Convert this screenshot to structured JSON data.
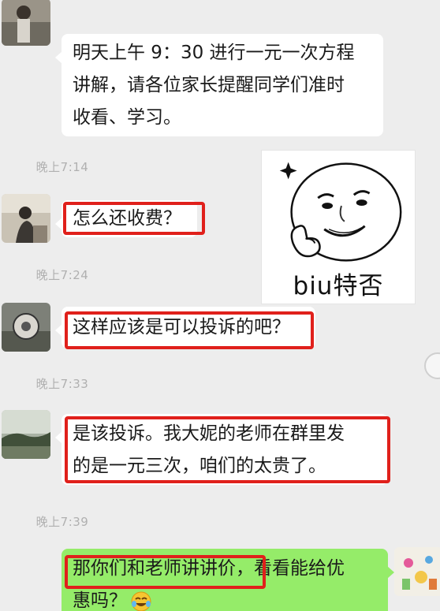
{
  "messages": [
    {
      "lines": [
        "明天上午 9：30 进行一元一次方程",
        "讲解，请各位家长提醒同学们准时",
        "收看、学习。"
      ]
    },
    {
      "text": "怎么还收费？"
    },
    {
      "text": "这样应该是可以投诉的吧？"
    },
    {
      "lines": [
        "是该投诉。我大妮的老师在群里发",
        "的是一元三次，咱们的太贵了。"
      ]
    },
    {
      "line1_boxed": "那你们和老师讲讲价，",
      "line1_rest": "看看能给优",
      "line2": "惠吗？"
    }
  ],
  "timestamps": [
    "晚上7:14",
    "晚上7:24",
    "晚上7:33",
    "晚上7:39"
  ],
  "sticker": {
    "caption": "biu特否",
    "icon": "smirk-face-thumbs-up-sticker"
  },
  "colors": {
    "background": "#ededed",
    "bubble_incoming": "#ffffff",
    "bubble_outgoing": "#95ec69",
    "highlight_box": "#e0201b",
    "timestamp_text": "#b0b0b0"
  },
  "icons": [
    "avatar-person-photo",
    "avatar-road-photo",
    "avatar-landscape-photo",
    "avatar-self-cartoon",
    "laughing-crying-emoji",
    "smirk-face-thumbs-up-sticker"
  ]
}
